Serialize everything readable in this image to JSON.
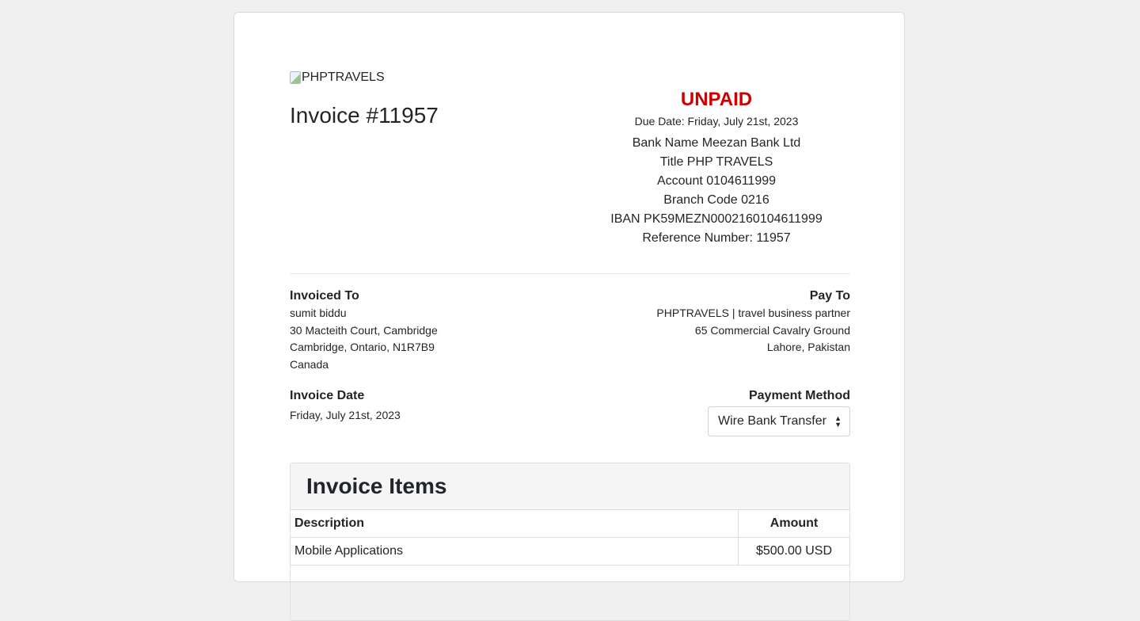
{
  "logo_alt": "PHPTRAVELS",
  "invoice": {
    "title": "Invoice #11957",
    "status": "UNPAID",
    "status_color": "#cc0000",
    "due_date": "Due Date: Friday, July 21st, 2023"
  },
  "bank": {
    "lines": [
      "Bank Name Meezan Bank Ltd",
      "Title PHP TRAVELS",
      "Account 0104611999",
      "Branch Code 0216",
      "IBAN PK59MEZN0002160104611999",
      "Reference Number: 11957"
    ]
  },
  "invoiced_to": {
    "label": "Invoiced To",
    "lines": [
      "sumit biddu",
      "30 Macteith Court, Cambridge",
      "Cambridge, Ontario, N1R7B9",
      "Canada"
    ]
  },
  "pay_to": {
    "label": "Pay To",
    "lines": [
      "PHPTRAVELS | travel business partner",
      "65 Commercial Cavalry Ground",
      "Lahore, Pakistan"
    ]
  },
  "invoice_date": {
    "label": "Invoice Date",
    "value": "Friday, July 21st, 2023"
  },
  "payment_method": {
    "label": "Payment Method",
    "selected": "Wire Bank Transfer"
  },
  "items": {
    "heading": "Invoice Items",
    "columns": [
      "Description",
      "Amount"
    ],
    "rows": [
      {
        "description": "Mobile Applications",
        "amount": "$500.00 USD"
      }
    ]
  }
}
